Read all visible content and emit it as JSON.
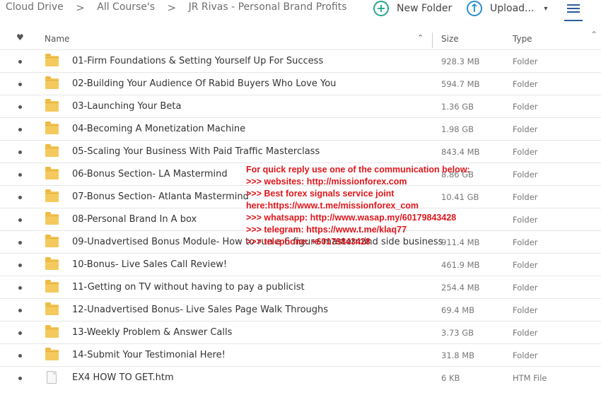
{
  "breadcrumb": {
    "items": [
      "Cloud Drive",
      "All Course's",
      "JR Rivas - Personal Brand Profits"
    ],
    "separator": ">"
  },
  "toolbar": {
    "new_folder_label": "New Folder",
    "new_folder_icon": "plus-circle-icon",
    "upload_label": "Upload...",
    "upload_icon": "arrow-up-circle-icon",
    "upload_caret": "▾",
    "view_icon": "list-view-icon"
  },
  "header": {
    "favorite_glyph": "♥",
    "name": "Name",
    "sort_glyph": "⌃",
    "size": "Size",
    "type": "Type",
    "more_glyph": "⌃"
  },
  "rows": [
    {
      "icon": "folder",
      "name": "01-Firm Foundations & Setting Yourself Up For Success",
      "size": "928.3 MB",
      "type": "Folder"
    },
    {
      "icon": "folder",
      "name": "02-Building Your Audience Of Rabid Buyers Who Love You",
      "size": "594.7 MB",
      "type": "Folder"
    },
    {
      "icon": "folder",
      "name": "03-Launching Your Beta",
      "size": "1.36 GB",
      "type": "Folder"
    },
    {
      "icon": "folder",
      "name": "04-Becoming A Monetization Machine",
      "size": "1.98 GB",
      "type": "Folder"
    },
    {
      "icon": "folder",
      "name": "05-Scaling Your Business With Paid Traffic Masterclass",
      "size": "843.4 MB",
      "type": "Folder"
    },
    {
      "icon": "folder",
      "name": "06-Bonus Section- LA Mastermind",
      "size": "8.86 GB",
      "type": "Folder"
    },
    {
      "icon": "folder",
      "name": "07-Bonus Section- Atlanta Mastermind",
      "size": "10.41 GB",
      "type": "Folder"
    },
    {
      "icon": "folder",
      "name": "08-Personal Brand In A box",
      "size": "",
      "type": "Folder"
    },
    {
      "icon": "folder",
      "name": "09-Unadvertised Bonus Module- How to run a 6 figure mastermind side business",
      "size": "911.4 MB",
      "type": "Folder"
    },
    {
      "icon": "folder",
      "name": "10-Bonus- Live Sales Call Review!",
      "size": "461.9 MB",
      "type": "Folder"
    },
    {
      "icon": "folder",
      "name": "11-Getting on TV without having to pay a publicist",
      "size": "254.4 MB",
      "type": "Folder"
    },
    {
      "icon": "folder",
      "name": "12-Unadvertised Bonus- Live Sales Page Walk Throughs",
      "size": "69.4 MB",
      "type": "Folder"
    },
    {
      "icon": "folder",
      "name": "13-Weekly Problem & Answer Calls",
      "size": "3.73 GB",
      "type": "Folder"
    },
    {
      "icon": "folder",
      "name": "14-Submit Your Testimonial Here!",
      "size": "31.8 MB",
      "type": "Folder"
    },
    {
      "icon": "file",
      "name": "EX4 HOW TO GET.htm",
      "size": "6 KB",
      "type": "HTM File"
    }
  ],
  "overlay_lines": [
    "For quick reply use one of the communication below:",
    ">>> websites: http://missionforex.com",
    ">>> Best forex signals service joint",
    "here:https://www.t.me/missionforex_com",
    ">>> whatsapp: http://www.wasap.my/60179843428",
    ">>> telegram: https://www.t.me/klaq77",
    ">>> telephone: +60179843428"
  ],
  "colors": {
    "accent_green": "#25a68d",
    "accent_blue": "#2a8fcf",
    "folder_yellow": "#f4c95d",
    "overlay_red": "#e0161b"
  }
}
